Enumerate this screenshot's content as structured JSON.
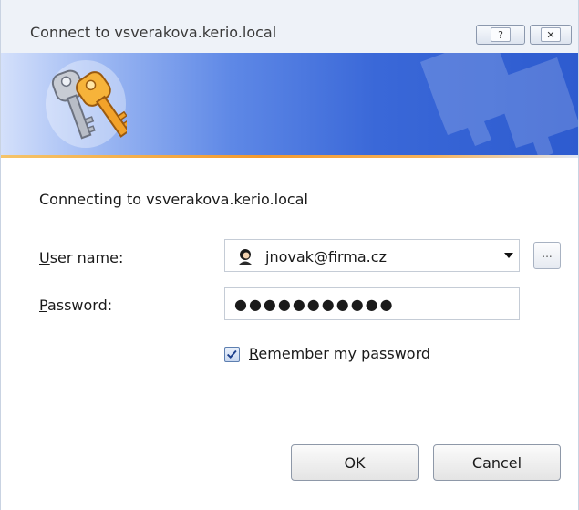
{
  "window": {
    "title": "Connect to vsverakova.kerio.local",
    "help_glyph": "?",
    "close_glyph": "✕"
  },
  "banner": {
    "icon": "keys-icon",
    "watermark": "keys-watermark-icon",
    "gradient_colors": [
      "#d4e0fb",
      "#3a68d8"
    ],
    "accent_line_color": "#f49a2e"
  },
  "form": {
    "status_text": "Connecting to vsverakova.kerio.local",
    "username_label_accel": "U",
    "username_label_rest": "ser name:",
    "username_value": "jnovak@firma.cz",
    "username_icon": "user-avatar-icon",
    "browse_label": "...",
    "password_label_accel": "P",
    "password_label_rest": "assword:",
    "password_masked": "●●●●●●●●●●●",
    "remember_checked": true,
    "remember_label_accel": "R",
    "remember_label_rest": "emember my password"
  },
  "buttons": {
    "ok": "OK",
    "cancel": "Cancel"
  }
}
